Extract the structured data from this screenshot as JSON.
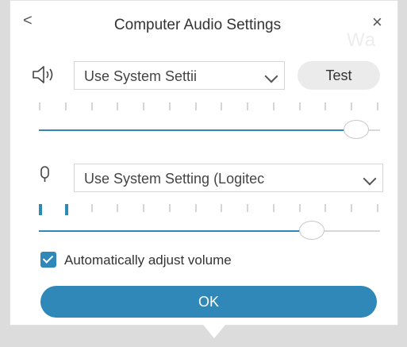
{
  "header": {
    "back_label": "<",
    "title": "Computer Audio Settings",
    "close_label": "×",
    "watermark": "Wa"
  },
  "speaker": {
    "icon": "speaker-icon",
    "selected_value": "Use System Settii",
    "test_label": "Test",
    "volume_level": 0.93
  },
  "microphone": {
    "icon": "microphone-icon",
    "selected_value": "Use System Setting (Logitec",
    "input_level_segments_on": 2,
    "volume_level": 0.8
  },
  "auto_adjust": {
    "checked": true,
    "label": "Automatically adjust volume"
  },
  "ok_label": "OK",
  "colors": {
    "accent": "#2f88b8",
    "track": "#d8d8d8",
    "test_button_bg": "#ebebeb"
  }
}
